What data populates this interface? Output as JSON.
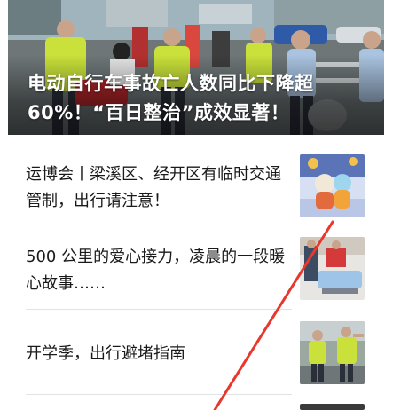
{
  "hero": {
    "title": "电动自行车事故亡人数同比下降超60%！“百日整治”成效显著！"
  },
  "news": [
    {
      "title": "运博会丨梁溪区、经开区有临时交通管制，出行请注意！",
      "thumb_icon": "mascot-photo-thumbnail"
    },
    {
      "title": "500 公里的爱心接力，凌晨的一段暖心故事……",
      "thumb_icon": "hospital-photo-thumbnail"
    },
    {
      "title": "开学季，出行避堵指南",
      "thumb_icon": "traffic-police-photo-thumbnail"
    }
  ],
  "colors": {
    "annotation_line": "#e8372d",
    "police_vest": "#c9e13a",
    "divider": "#e3e3e3"
  }
}
